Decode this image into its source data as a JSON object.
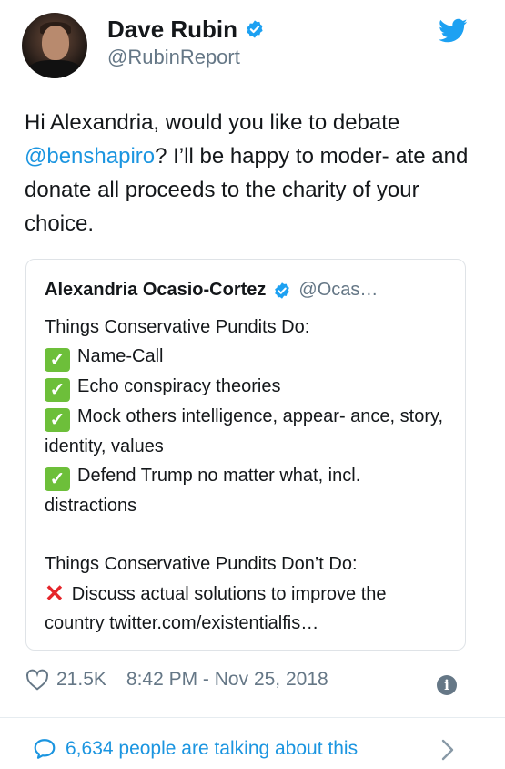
{
  "tweet": {
    "author_name": "Dave Rubin",
    "author_handle": "@RubinReport",
    "text_before": "Hi Alexandria, would you like to debate ",
    "mention": "@benshapiro",
    "text_after": "? I’ll be happy to moder- ate and donate all proceeds to the charity of your choice."
  },
  "quote": {
    "author_name": "Alexandria Ocasio-Cortez",
    "author_handle": "@Ocas…",
    "intro": "Things Conservative Pundits Do:",
    "do_items": [
      "Name-Call",
      "Echo conspiracy theories",
      "Mock others intelligence, appear- ance, story, identity, values",
      "Defend Trump no matter what, incl. distractions"
    ],
    "dont_intro": "Things Conservative Pundits Don’t Do:",
    "dont_item": "Discuss actual solutions to improve the country twitter.com/existentialfis…"
  },
  "meta": {
    "likes": "21.5K",
    "timestamp": "8:42 PM - Nov 25, 2018"
  },
  "footer": {
    "talking_text": "6,634 people are talking about this"
  },
  "colors": {
    "link": "#1b95e0",
    "secondary": "#657786",
    "check_green": "#6dbf3a",
    "cross_red": "#e5262b"
  }
}
